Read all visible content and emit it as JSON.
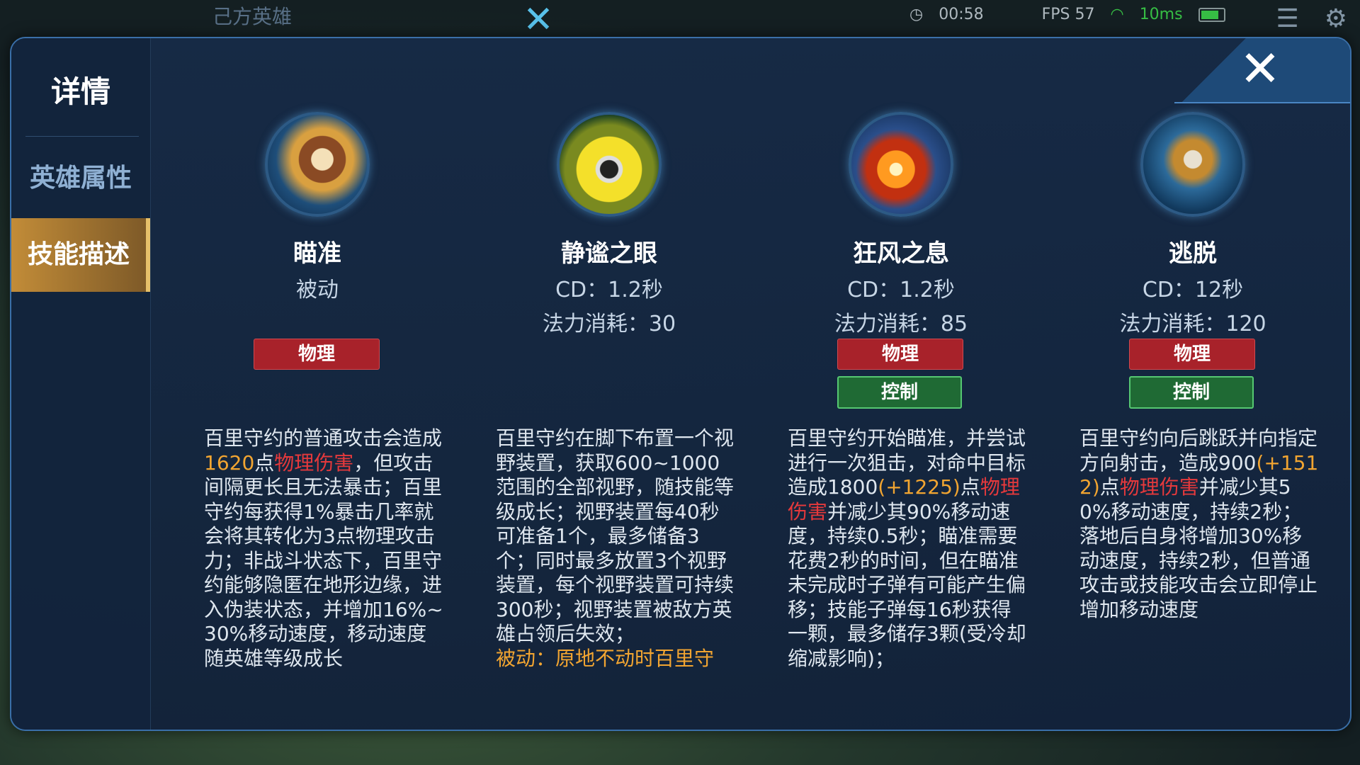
{
  "hud": {
    "title": "己方英雄",
    "time": "00:58",
    "fps": "FPS 57",
    "ping": "10ms"
  },
  "panel": {
    "close_glyph": "✕"
  },
  "sidebar": {
    "title": "详情",
    "items": [
      {
        "label": "英雄属性",
        "active": false
      },
      {
        "label": "技能描述",
        "active": true
      }
    ]
  },
  "skills": [
    {
      "name": "瞄准",
      "line1": "被动",
      "line2": "",
      "tags": [
        "物理"
      ],
      "icon": "skill-aim-icon",
      "desc": {
        "p1": "百里守约的普通攻击会造成",
        "v1": "1620",
        "p2": "点",
        "v2": "物理伤害",
        "p3": "，但攻击间隔更长且无法暴击；百里守约每获得1%暴击几率就会将其转化为3点物理攻击力；非战斗状态下，百里守约能够隐匿在地形边缘，进入伪装状态，并增加16%~30%移动速度，移动速度随英雄等级成长"
      }
    },
    {
      "name": "静谧之眼",
      "line1": "CD：1.2秒",
      "line2": "法力消耗：30",
      "tags": [],
      "icon": "skill-eye-icon",
      "desc": {
        "p1": "百里守约在脚下布置一个视野装置，获取600~1000范围的全部视野，随技能等级成长；视野装置每40秒可准备1个，最多储备3个；同时最多放置3个视野装置，每个视野装置可持续300秒；视野装置被敌方英雄占领后失效；",
        "v1": "被动：原地不动时百里守"
      }
    },
    {
      "name": "狂风之息",
      "line1": "CD：1.2秒",
      "line2": "法力消耗：85",
      "tags": [
        "物理",
        "控制"
      ],
      "icon": "skill-bullet-icon",
      "desc": {
        "p1": "百里守约开始瞄准，并尝试进行一次狙击，对命中目标造成1800",
        "v1": "(+1225)",
        "p2": "点",
        "v2": "物理伤害",
        "p3": "并减少其90%移动速度，持续0.5秒；瞄准需要花费2秒的时间，但在瞄准未完成时子弹有可能产生偏移；技能子弹每16秒获得一颗，最多储存3颗(受冷却缩减影响)；"
      }
    },
    {
      "name": "逃脱",
      "line1": "CD：12秒",
      "line2": "法力消耗：120",
      "tags": [
        "物理",
        "控制"
      ],
      "icon": "skill-escape-icon",
      "desc": {
        "p1": "百里守约向后跳跃并向指定方向射击，造成900",
        "v1": "(+1512)",
        "p2": "点",
        "v2": "物理伤害",
        "p3": "并减少其50%移动速度，持续2秒；落地后自身将增加30%移动速度，持续2秒，但普通攻击或技能攻击会立即停止增加移动速度"
      }
    }
  ]
}
